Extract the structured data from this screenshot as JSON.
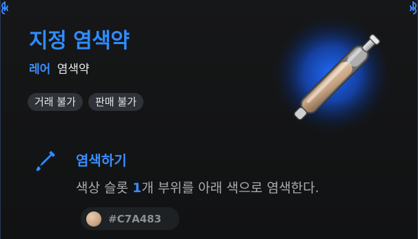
{
  "item": {
    "name": "지정 염색약",
    "rarity": "레어",
    "type": "염색약",
    "tags": [
      "거래 불가",
      "판매 불가"
    ]
  },
  "effect": {
    "title": "염색하기",
    "desc_before": "색상 슬롯 ",
    "desc_number": "1",
    "desc_after": "개 부위를 아래 색으로 염색한다."
  },
  "color": {
    "hex": "#C7A483",
    "swatch": "#C7A483"
  },
  "icons": {
    "item": "dye-vial-icon",
    "effect": "dye-dropper-icon",
    "corner": "ornament-icon"
  },
  "colors": {
    "accent": "#2F8CFF",
    "glow": "#1B5BD6"
  }
}
